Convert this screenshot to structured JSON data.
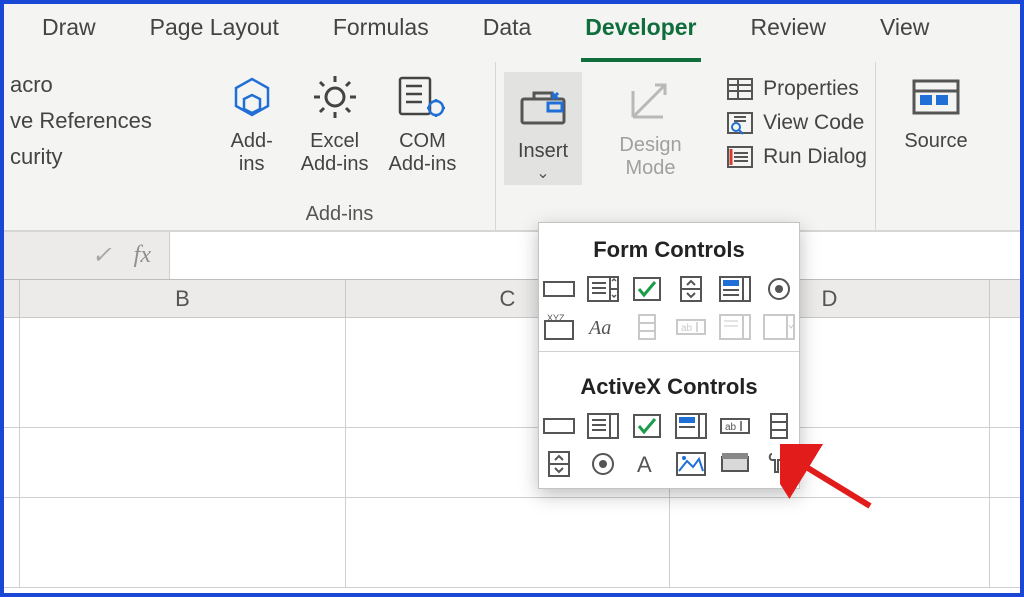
{
  "tabs": {
    "draw": "Draw",
    "page_layout": "Page Layout",
    "formulas": "Formulas",
    "data": "Data",
    "developer": "Developer",
    "review": "Review",
    "view": "View"
  },
  "left_items": {
    "macro": "acro",
    "relrefs": "ve References",
    "security": "curity"
  },
  "addins_group": {
    "label": "Add-ins",
    "addins": "Add-\nins",
    "excel": "Excel\nAdd-ins",
    "com": "COM\nAdd-ins"
  },
  "controls_group": {
    "insert": "Insert",
    "design": "Design\nMode",
    "properties": "Properties",
    "view_code": "View Code",
    "run_dialog": "Run Dialog"
  },
  "xml_group": {
    "source": "Source"
  },
  "formula_bar": {
    "fx": "fx",
    "value": ""
  },
  "columns": {
    "B": "B",
    "C": "C",
    "D": "D"
  },
  "dropdown": {
    "form": "Form Controls",
    "activex": "ActiveX Controls",
    "form_items": [
      "button",
      "combo-box",
      "check-box",
      "spin-button",
      "list-box",
      "option-button",
      "group-box",
      "label",
      "scroll-bar",
      "text-field",
      "combo-list",
      "combo-dropdown"
    ],
    "activex_items": [
      "command-button",
      "combo-box",
      "check-box",
      "list-box",
      "text-box",
      "scroll-bar",
      "spin-button",
      "option-button",
      "label",
      "image",
      "toggle-button",
      "more-controls"
    ]
  }
}
